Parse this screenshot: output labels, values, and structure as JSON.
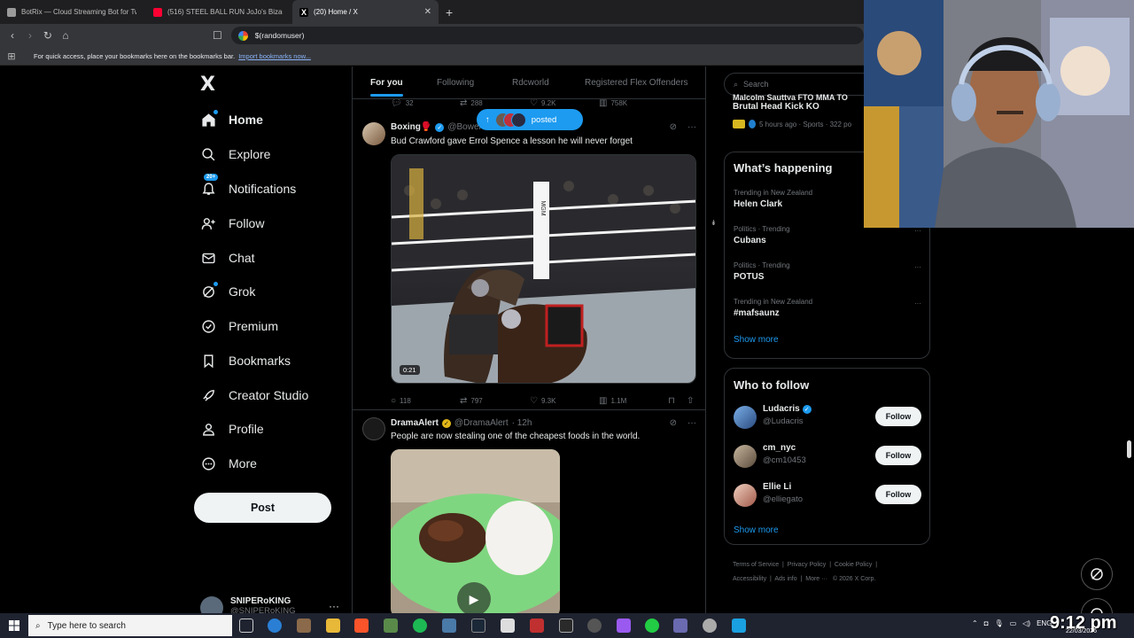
{
  "browser": {
    "tabs": [
      {
        "title": "BotRix — Cloud Streaming Bot for Tw",
        "color": "#b0b0b0"
      },
      {
        "title": "(516) STEEL BALL RUN JoJo's Bizarre",
        "color": "#ff0033"
      },
      {
        "title": "(20) Home / X",
        "color": "#ffffff"
      }
    ],
    "address": "$(randomuser)",
    "bookmarks_prompt": "For quick access, place your bookmarks here on the bookmarks bar.",
    "bookmarks_import": "Import bookmarks now..."
  },
  "nav": {
    "logo": "X",
    "items": [
      {
        "label": "Home",
        "icon": "home-icon",
        "glyph": "⌂"
      },
      {
        "label": "Explore",
        "icon": "search-icon",
        "glyph": "⌕"
      },
      {
        "label": "Notifications",
        "icon": "bell-icon",
        "glyph": "🔔",
        "badge": "20+"
      },
      {
        "label": "Follow",
        "icon": "person-add-icon",
        "glyph": "👤"
      },
      {
        "label": "Chat",
        "icon": "mail-icon",
        "glyph": "✉"
      },
      {
        "label": "Grok",
        "icon": "grok-icon",
        "glyph": "⊘"
      },
      {
        "label": "Premium",
        "icon": "premium-icon",
        "glyph": "✓"
      },
      {
        "label": "Bookmarks",
        "icon": "bookmark-icon",
        "glyph": "🔖"
      },
      {
        "label": "Creator Studio",
        "icon": "rocket-icon",
        "glyph": "🚀"
      },
      {
        "label": "Profile",
        "icon": "profile-icon",
        "glyph": "👤"
      },
      {
        "label": "More",
        "icon": "more-icon",
        "glyph": "⋯"
      }
    ],
    "post_label": "Post",
    "account": {
      "name": "SNIPERoKING",
      "handle": "@SNIPERoKING",
      "more": "···"
    }
  },
  "timeline": {
    "tabs": [
      "For you",
      "Following",
      "Rdcworld",
      "Registered Flex Offenders"
    ],
    "prev_tweet_stats": {
      "replies": "32",
      "reposts": "288",
      "likes": "9.2K",
      "views": "758K"
    },
    "posted_pill": "posted",
    "tweets": [
      {
        "name": "Boxing🥊",
        "handle": "@Bower",
        "text": "Bud Crawford gave Errol Spence a lesson he will never forget",
        "duration": "0:21",
        "stats": {
          "replies": "118",
          "reposts": "797",
          "likes": "9.3K",
          "views": "1.1M"
        }
      },
      {
        "name": "DramaAlert",
        "handle": "@DramaAlert",
        "time": "· 12h",
        "text": "People are now stealing one of the cheapest foods in the world."
      }
    ]
  },
  "sidebar": {
    "search_placeholder": "Search",
    "top_news": {
      "line1": "Malcolm Sauttya FTO MMA TO",
      "title": "Brutal Head Kick KO",
      "meta": "5 hours ago · Sports · 322 po"
    },
    "happening_title": "What’s happening",
    "trends": [
      {
        "context": "Trending in New Zealand",
        "title": "Helen Clark"
      },
      {
        "context": "Politics · Trending",
        "title": "Cubans"
      },
      {
        "context": "Politics · Trending",
        "title": "POTUS"
      },
      {
        "context": "Trending in New Zealand",
        "title": "#mafsaunz"
      }
    ],
    "show_more": "Show more",
    "who_title": "Who to follow",
    "who": [
      {
        "name": "Ludacris",
        "handle": "@Ludacris",
        "verified": true,
        "color": "#4a7ab8"
      },
      {
        "name": "cm_nyc",
        "handle": "@cm10453",
        "verified": false,
        "color": "#9a8a78"
      },
      {
        "name": "Ellie Li",
        "handle": "@elliegato",
        "verified": false,
        "color": "#d8a892"
      }
    ],
    "follow_label": "Follow",
    "footer": [
      "Terms of Service",
      "Privacy Policy",
      "Cookie Policy",
      "Accessibility",
      "Ads info",
      "More ···",
      "© 2026 X Corp."
    ]
  },
  "taskbar": {
    "search_placeholder": "Type here to search",
    "clock": "9:12 pm",
    "date": "22/03/2026",
    "lang": "ENG"
  },
  "colors": {
    "accent": "#1d9bf0",
    "background": "#000000",
    "border": "#2f3336",
    "muted": "#71767b"
  }
}
